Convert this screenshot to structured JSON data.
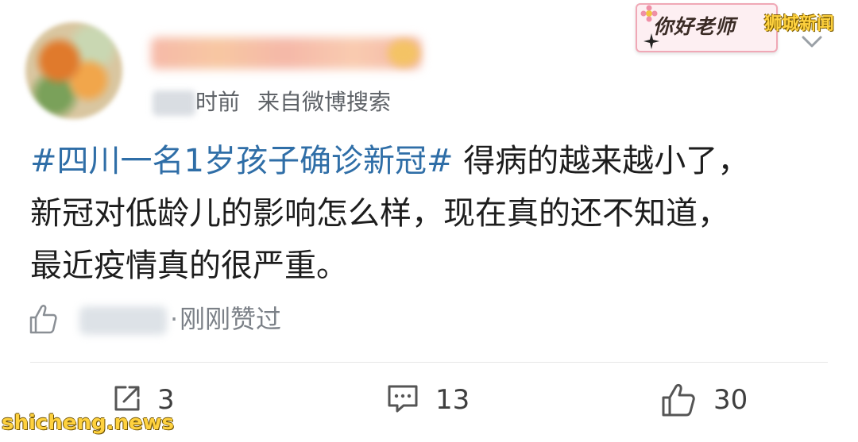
{
  "author": {
    "name": "",
    "time_suffix": "时前",
    "source": "来自微博搜索"
  },
  "post": {
    "hashtag": "#四川一名1岁孩子确诊新冠#",
    "line1": " 得病的越来越小了，",
    "line2": "新冠对低龄儿的影响怎么样，现在真的还不知道，",
    "line3": "最近疫情真的很严重。"
  },
  "likes_row": {
    "dot": "·",
    "text": "刚刚赞过"
  },
  "actions": {
    "repost_count": "3",
    "comment_count": "13",
    "like_count": "30"
  },
  "watermark": {
    "badge_text": "你好老师",
    "source_tag": "狮城新闻",
    "site": "shicheng.news"
  },
  "icons": {
    "more": "chevron-down-icon",
    "like_small": "thumbs-up-icon",
    "repost": "share-icon",
    "comment": "comment-icon",
    "like": "thumbs-up-icon"
  },
  "colors": {
    "hashtag": "#2f6ea7",
    "meta": "#5f6368",
    "watermark_yellow": "#ffd23f"
  }
}
